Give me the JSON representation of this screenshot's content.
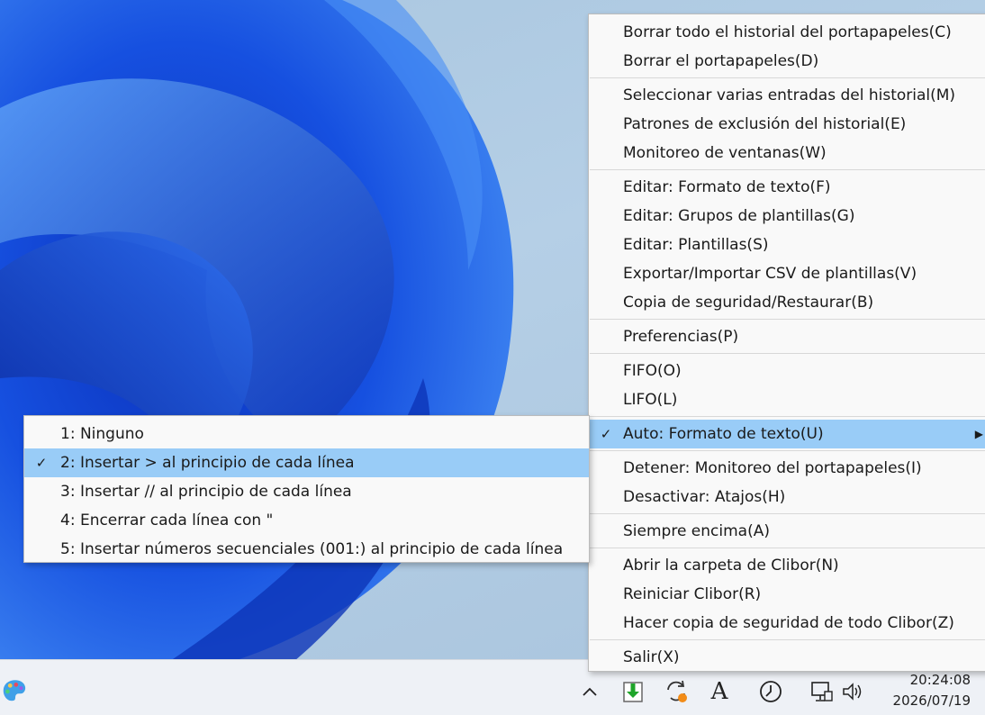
{
  "main_menu": {
    "groups": [
      [
        {
          "label": "Borrar todo el historial del portapapeles(C)"
        },
        {
          "label": "Borrar el portapapeles(D)"
        }
      ],
      [
        {
          "label": "Seleccionar varias entradas del historial(M)"
        },
        {
          "label": "Patrones de exclusión del historial(E)"
        },
        {
          "label": "Monitoreo de ventanas(W)"
        }
      ],
      [
        {
          "label": "Editar: Formato de texto(F)"
        },
        {
          "label": "Editar: Grupos de plantillas(G)"
        },
        {
          "label": "Editar: Plantillas(S)"
        },
        {
          "label": "Exportar/Importar CSV de plantillas(V)"
        },
        {
          "label": "Copia de seguridad/Restaurar(B)"
        }
      ],
      [
        {
          "label": "Preferencias(P)"
        }
      ],
      [
        {
          "label": "FIFO(O)"
        },
        {
          "label": "LIFO(L)"
        }
      ],
      [
        {
          "label": "Auto: Formato de texto(U)",
          "checked": true,
          "submenu": true,
          "highlighted": true
        }
      ],
      [
        {
          "label": "Detener: Monitoreo del portapapeles(I)"
        },
        {
          "label": "Desactivar: Atajos(H)"
        }
      ],
      [
        {
          "label": "Siempre encima(A)"
        }
      ],
      [
        {
          "label": "Abrir la carpeta de Clibor(N)"
        },
        {
          "label": "Reiniciar Clibor(R)"
        },
        {
          "label": "Hacer copia de seguridad de todo Clibor(Z)"
        }
      ],
      [
        {
          "label": "Salir(X)"
        }
      ]
    ],
    "check_glyph": "✓",
    "submenu_glyph": "▶"
  },
  "sub_menu": {
    "items": [
      {
        "label": "1: Ninguno"
      },
      {
        "label": "2: Insertar > al principio de cada línea",
        "checked": true,
        "highlighted": true
      },
      {
        "label": "3: Insertar // al principio de cada línea"
      },
      {
        "label": "4: Encerrar cada línea con \""
      },
      {
        "label": "5: Insertar números secuenciales (001:) al principio de cada línea"
      }
    ]
  },
  "taskbar": {
    "clock_time": "20:24:08",
    "clock_date": "2026/07/19",
    "tray_icons": [
      "chevron-up-icon",
      "clibor-download-icon",
      "sync-icon",
      "font-a-icon",
      "clock-timer-icon",
      "network-icon",
      "volume-icon"
    ],
    "chevron_glyph": "^",
    "font_glyph": "A"
  },
  "colors": {
    "highlight": "#99ccf7",
    "menu_bg": "#f9f9f9",
    "wallpaper_blue": "#1a4fd6"
  }
}
